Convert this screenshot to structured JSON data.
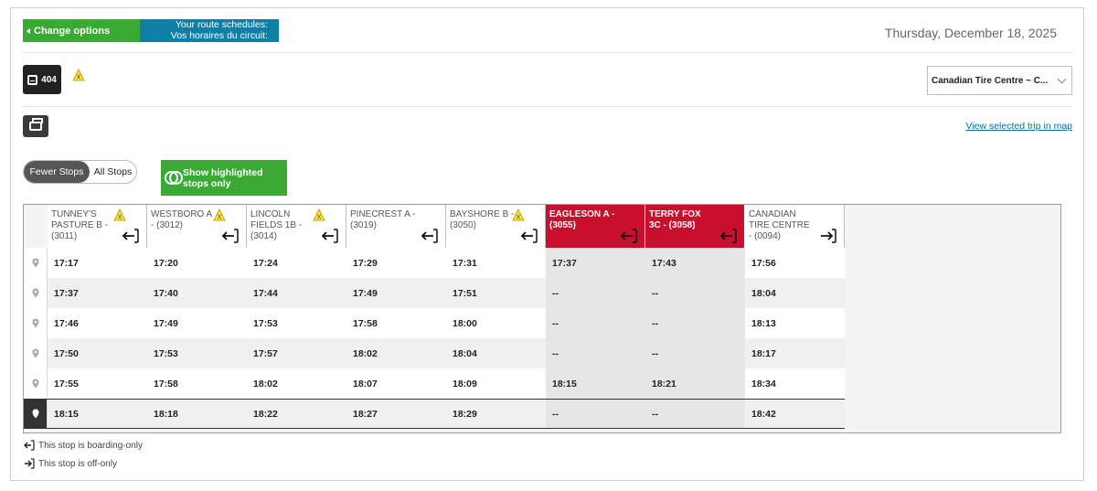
{
  "header": {
    "change_options": "Change options",
    "route_schedules_en": "Your route schedules:",
    "route_schedules_fr": "Vos horaires du circuit:",
    "date": "Thursday, December 18, 2025"
  },
  "route": {
    "number": "404",
    "bus_icon": "bus-icon",
    "alert_icon": "warning-icon"
  },
  "destination_select": {
    "value": "Canadian Tire Centre ~ C..."
  },
  "actions": {
    "print_icon": "printer-icon",
    "view_map_link": "View selected trip in map"
  },
  "stop_toggle": {
    "selected": "Fewer Stops",
    "options": [
      "Fewer Stops",
      "All Stops"
    ]
  },
  "highlight_button": {
    "line1": "Show highlighted",
    "line2": "stops only"
  },
  "colors": {
    "green": "#3aaa35",
    "blue": "#0f7fa5",
    "highlight_red": "#c8102e"
  },
  "stops": [
    {
      "name": "TUNNEY'S PASTURE B - (3011)",
      "alert": true,
      "type": "boarding-only",
      "highlighted": false
    },
    {
      "name": "WESTBORO A - (3012)",
      "alert": true,
      "type": "boarding-only",
      "highlighted": false
    },
    {
      "name": "LINCOLN FIELDS 1B - (3014)",
      "alert": true,
      "type": "boarding-only",
      "highlighted": false
    },
    {
      "name": "PINECREST A - (3019)",
      "alert": false,
      "type": "boarding-only",
      "highlighted": false
    },
    {
      "name": "BAYSHORE B - (3050)",
      "alert": true,
      "type": "boarding-only",
      "highlighted": false
    },
    {
      "name": "EAGLESON A - (3055)",
      "alert": false,
      "type": "boarding-only",
      "highlighted": true
    },
    {
      "name": "TERRY FOX 3C - (3058)",
      "alert": false,
      "type": "boarding-only",
      "highlighted": true
    },
    {
      "name": "CANADIAN TIRE CENTRE - (0094)",
      "alert": false,
      "type": "off-only",
      "highlighted": false
    }
  ],
  "trips": [
    {
      "selected": false,
      "times": [
        "17:17",
        "17:20",
        "17:24",
        "17:29",
        "17:31",
        "17:37",
        "17:43",
        "17:56"
      ]
    },
    {
      "selected": false,
      "times": [
        "17:37",
        "17:40",
        "17:44",
        "17:49",
        "17:51",
        "--",
        "--",
        "18:04"
      ]
    },
    {
      "selected": false,
      "times": [
        "17:46",
        "17:49",
        "17:53",
        "17:58",
        "18:00",
        "--",
        "--",
        "18:13"
      ]
    },
    {
      "selected": false,
      "times": [
        "17:50",
        "17:53",
        "17:57",
        "18:02",
        "18:04",
        "--",
        "--",
        "18:17"
      ]
    },
    {
      "selected": false,
      "times": [
        "17:55",
        "17:58",
        "18:02",
        "18:07",
        "18:09",
        "18:15",
        "18:21",
        "18:34"
      ]
    },
    {
      "selected": true,
      "times": [
        "18:15",
        "18:18",
        "18:22",
        "18:27",
        "18:29",
        "--",
        "--",
        "18:42"
      ]
    }
  ],
  "legend": {
    "boarding_only": "This stop is boarding-only",
    "off_only": "This stop is off-only"
  }
}
